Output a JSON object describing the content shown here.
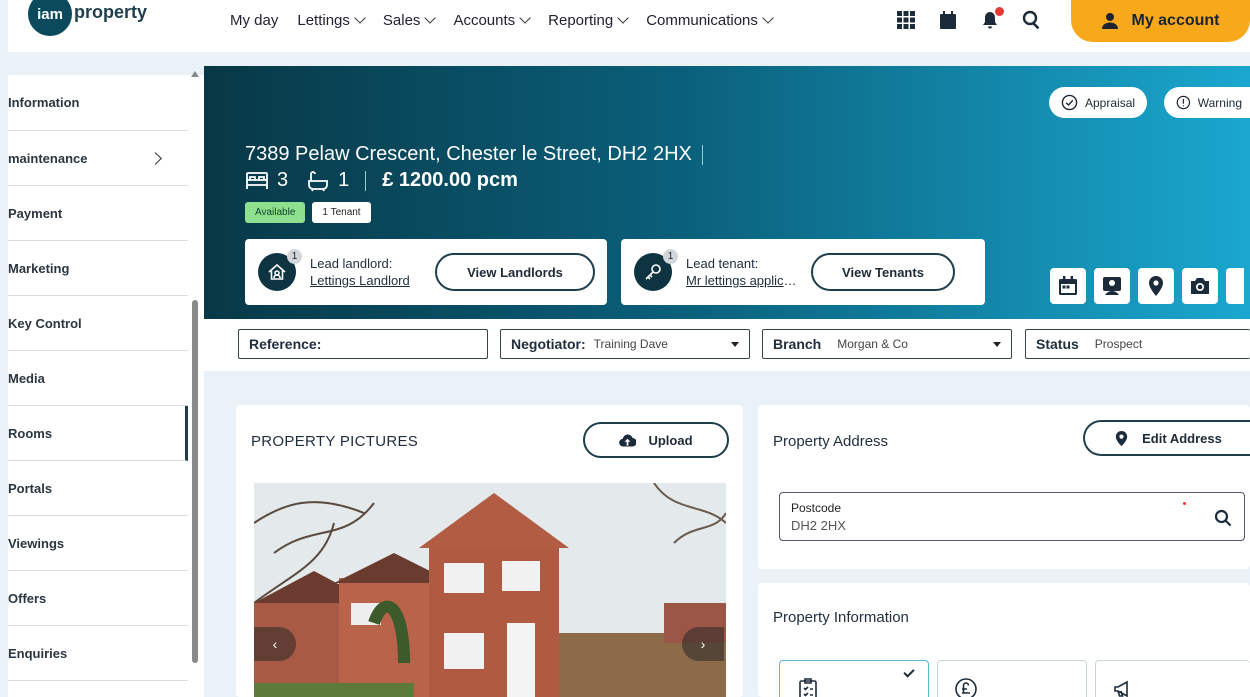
{
  "logo": {
    "badge": "iam",
    "text": "property"
  },
  "nav": [
    {
      "label": "My day",
      "dropdown": false
    },
    {
      "label": "Lettings",
      "dropdown": true
    },
    {
      "label": "Sales",
      "dropdown": true
    },
    {
      "label": "Accounts",
      "dropdown": true
    },
    {
      "label": "Reporting",
      "dropdown": true
    },
    {
      "label": "Communications",
      "dropdown": true
    }
  ],
  "top_icons": [
    "apps-grid-icon",
    "calendar-icon",
    "bell-icon",
    "search-icon"
  ],
  "account": {
    "label": "My account"
  },
  "sidebar": {
    "items": [
      {
        "label": "Information",
        "name": "information",
        "has_arrow": false,
        "active": false
      },
      {
        "label": "maintenance",
        "name": "maintenance",
        "has_arrow": true,
        "active": false
      },
      {
        "label": "Payment",
        "name": "payment",
        "has_arrow": false,
        "active": false
      },
      {
        "label": "Marketing",
        "name": "marketing",
        "has_arrow": false,
        "active": false
      },
      {
        "label": "Key Control",
        "name": "key-control",
        "has_arrow": false,
        "active": false
      },
      {
        "label": "Media",
        "name": "media",
        "has_arrow": false,
        "active": false
      },
      {
        "label": "Rooms",
        "name": "rooms",
        "has_arrow": false,
        "active": true
      },
      {
        "label": "Portals",
        "name": "portals",
        "has_arrow": false,
        "active": false
      },
      {
        "label": "Viewings",
        "name": "viewings",
        "has_arrow": false,
        "active": false
      },
      {
        "label": "Offers",
        "name": "offers",
        "has_arrow": false,
        "active": false
      },
      {
        "label": "Enquiries",
        "name": "enquiries",
        "has_arrow": false,
        "active": false
      }
    ]
  },
  "property": {
    "address": "7389 Pelaw Crescent, Chester le Street, DH2 2HX",
    "bedrooms": "3",
    "bathrooms": "1",
    "price": "£ 1200.00 pcm",
    "status_tag": "Available",
    "tenant_tag": "1 Tenant"
  },
  "pills": {
    "appraisal": "Appraisal",
    "warning": "Warning"
  },
  "lead_landlord": {
    "count": "1",
    "title": "Lead landlord:",
    "name": "Lettings Landlord",
    "button": "View Landlords"
  },
  "lead_tenant": {
    "count": "1",
    "title": "Lead tenant:",
    "name": "Mr lettings applicant",
    "button": "View Tenants"
  },
  "action_icons": [
    "calendar-icon",
    "contact-icon",
    "location-pin-icon",
    "camera-icon"
  ],
  "filters": {
    "reference": {
      "label": "Reference:",
      "value": ""
    },
    "negotiator": {
      "label": "Negotiator:",
      "value": "Training Dave"
    },
    "branch": {
      "label": "Branch",
      "value": "Morgan & Co"
    },
    "status": {
      "label": "Status",
      "value": "Prospect"
    }
  },
  "pictures_card": {
    "title": "PROPERTY PICTURES",
    "upload": "Upload",
    "prev": "‹",
    "next": "›"
  },
  "address_card": {
    "title": "Property Address",
    "edit": "Edit Address",
    "postcode_label": "Postcode",
    "postcode_value": "DH2 2HX"
  },
  "info_card": {
    "title": "Property Information"
  }
}
